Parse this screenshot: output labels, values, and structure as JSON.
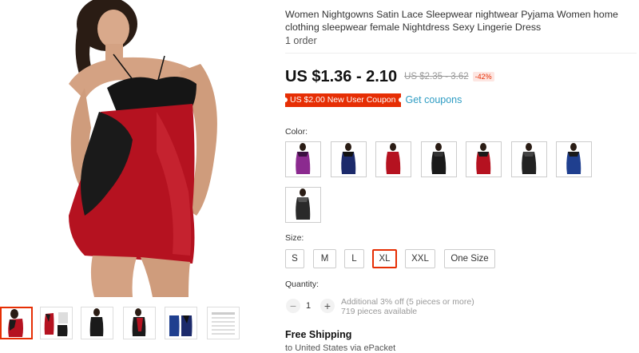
{
  "product": {
    "title": "Women Nightgowns Satin Lace Sleepwear nightwear Pyjama Women home clothing sleepwear female Nightdress Sexy Lingerie Dress",
    "orders": "1 order",
    "price": "US $1.36 - 2.10",
    "original_price": "US $2.35 - 3.62",
    "discount": "-42%",
    "coupon_label": "US $2.00 New User Coupon",
    "get_coupons": "Get coupons"
  },
  "color_section": {
    "label": "Color:",
    "options": [
      {
        "name": "purple",
        "dress": "#8b2a8f",
        "lace": "#3a1040"
      },
      {
        "name": "navy",
        "dress": "#1c2a6b",
        "lace": "#111"
      },
      {
        "name": "red",
        "dress": "#b51220",
        "lace": "#b51220"
      },
      {
        "name": "black",
        "dress": "#1a1a1a",
        "lace": "#333"
      },
      {
        "name": "red-black",
        "dress": "#b51220",
        "lace": "#1a1a1a"
      },
      {
        "name": "black-lace",
        "dress": "#222",
        "lace": "#444"
      },
      {
        "name": "blue",
        "dress": "#1f3f8f",
        "lace": "#1a1a1a"
      },
      {
        "name": "sheer-black",
        "dress": "#2a2a2a",
        "lace": "#555"
      }
    ]
  },
  "size_section": {
    "label": "Size:",
    "options": [
      "S",
      "M",
      "L",
      "XL",
      "XXL",
      "One Size"
    ],
    "selected": "XL"
  },
  "quantity_section": {
    "label": "Quantity:",
    "value": "1",
    "minus": "−",
    "plus": "+",
    "discount_note": "Additional 3% off (5 pieces or more)",
    "available": "719 pieces available"
  },
  "shipping": {
    "title": "Free Shipping",
    "destination": "to United States via ePacket"
  },
  "colors": {
    "accent": "#e62e04",
    "link": "#2e9cc3",
    "dress_red": "#b51220"
  }
}
